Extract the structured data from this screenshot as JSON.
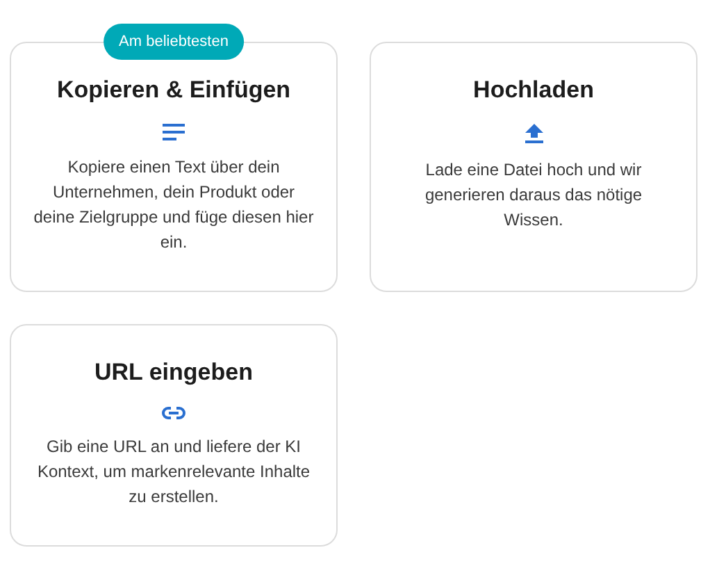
{
  "options": [
    {
      "kind": "text",
      "title": "Kopieren & Einfügen",
      "description": "Kopiere einen Text über dein Unternehmen, dein Produkt oder deine Zielgruppe und füge diesen hier ein.",
      "badge": "Am beliebtesten"
    },
    {
      "kind": "upload",
      "title": "Hochladen",
      "description": "Lade eine Datei hoch und wir generieren daraus das nötige Wissen."
    },
    {
      "kind": "url",
      "title": "URL eingeben",
      "description": "Gib eine URL an und liefere der KI Kontext, um markenrelevante Inhalte zu erstellen."
    }
  ]
}
